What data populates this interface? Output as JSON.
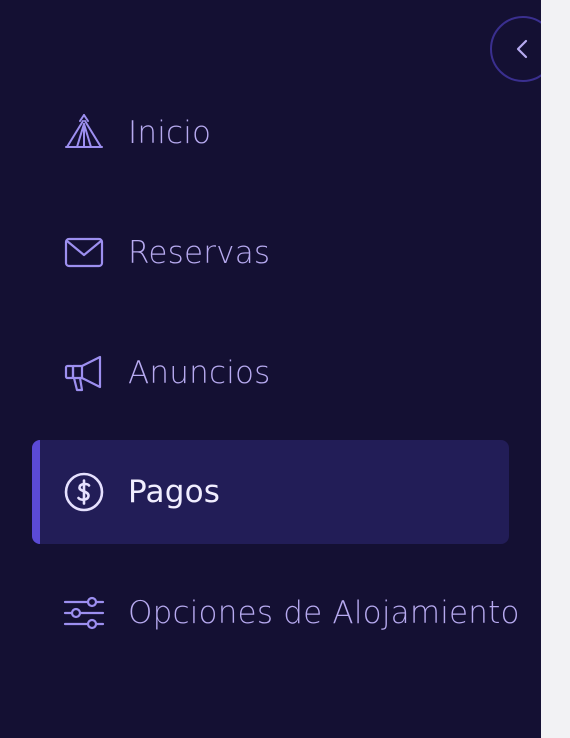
{
  "sidebar": {
    "colors": {
      "background": "#141033",
      "active_background": "#221d57",
      "active_indicator": "#5b4ad6",
      "label": "#b7aaf0",
      "active_label": "#f1eeff",
      "icon": "#9d8ff0"
    },
    "collapse_button": {
      "icon": "chevron-left-icon"
    },
    "items": [
      {
        "label": "Inicio",
        "icon": "tent-icon",
        "active": false
      },
      {
        "label": "Reservas",
        "icon": "envelope-icon",
        "active": false
      },
      {
        "label": "Anuncios",
        "icon": "megaphone-icon",
        "active": false
      },
      {
        "label": "Pagos",
        "icon": "dollar-circle-icon",
        "active": true
      },
      {
        "label": "Opciones de Alojamiento",
        "icon": "sliders-icon",
        "active": false
      }
    ]
  }
}
